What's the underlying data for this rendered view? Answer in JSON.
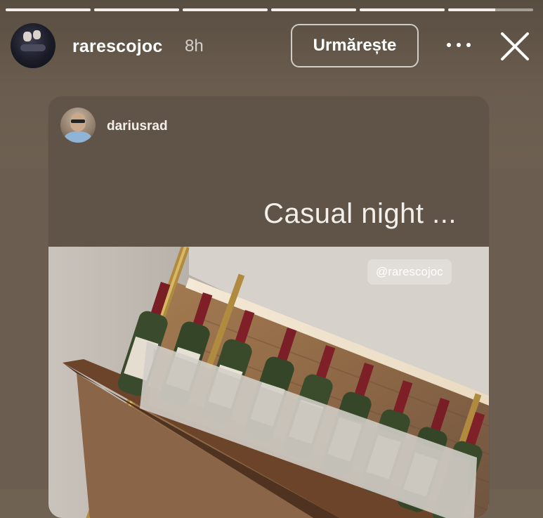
{
  "story": {
    "progress": [
      {
        "fill": 1.0
      },
      {
        "fill": 1.0
      },
      {
        "fill": 1.0
      },
      {
        "fill": 1.0
      },
      {
        "fill": 1.0
      },
      {
        "fill": 0.55
      }
    ]
  },
  "header": {
    "username": "rarescojoc",
    "time": "8h",
    "follow_label": "Urmărește",
    "more_icon": "more-horizontal-icon",
    "close_icon": "close-icon"
  },
  "reshared_post": {
    "username": "dariusrad",
    "caption": "Casual night ...",
    "mention": "@rarescojoc",
    "photo_description_icon": "wine-shelf-photo"
  },
  "colors": {
    "background": "#6f6253",
    "card": "#5f5447",
    "text": "#ffffff"
  }
}
